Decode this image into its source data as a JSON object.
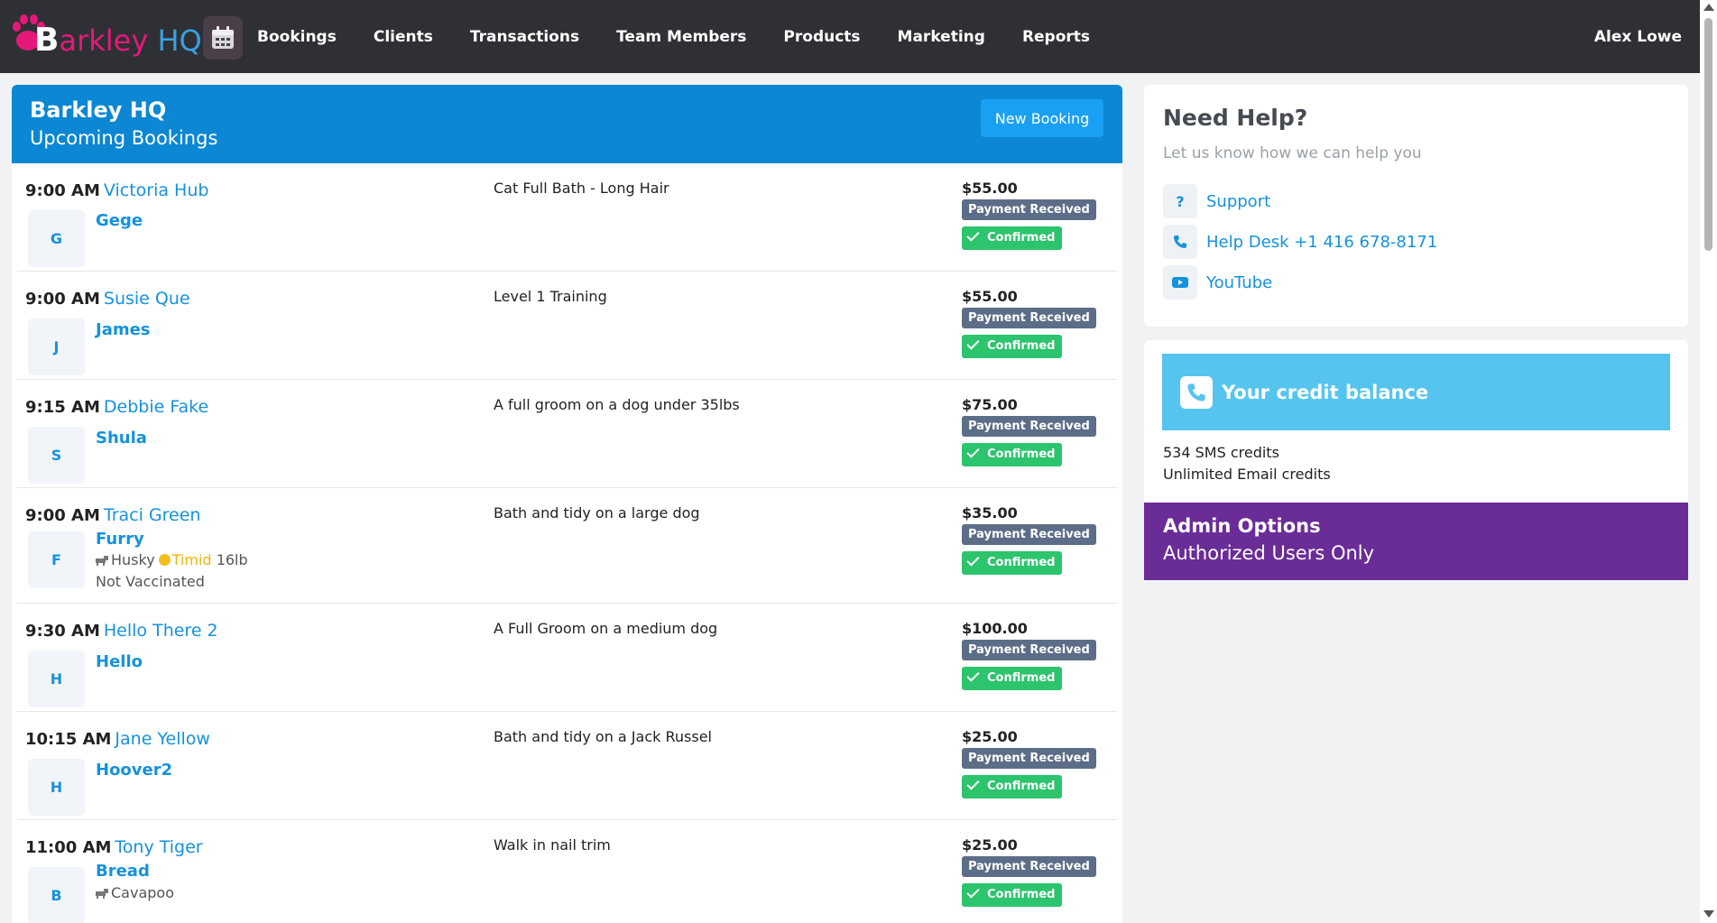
{
  "nav": {
    "brand_b": "B",
    "brand_arkley": "arkley",
    "brand_hq": "HQ",
    "items": [
      "Bookings",
      "Clients",
      "Transactions",
      "Team Members",
      "Products",
      "Marketing",
      "Reports"
    ],
    "user": "Alex Lowe"
  },
  "bookings": {
    "location": "Barkley HQ",
    "subtitle": "Upcoming Bookings",
    "new_booking_label": "New Booking",
    "rows": [
      {
        "time": "9:00 AM",
        "client": "Victoria Hub",
        "initial": "G",
        "pet": "Gege",
        "service": "Cat Full Bath - Long Hair",
        "price": "$55.00",
        "payment": "Payment Received",
        "status": "Confirmed"
      },
      {
        "time": "9:00 AM",
        "client": "Susie Que",
        "initial": "J",
        "pet": "James",
        "service": "Level 1 Training",
        "price": "$55.00",
        "payment": "Payment Received",
        "status": "Confirmed"
      },
      {
        "time": "9:15 AM",
        "client": "Debbie Fake",
        "initial": "S",
        "pet": "Shula",
        "service": "A full groom on a dog under 35lbs",
        "price": "$75.00",
        "payment": "Payment Received",
        "status": "Confirmed"
      },
      {
        "time": "9:00 AM",
        "client": "Traci Green",
        "initial": "F",
        "pet": "Furry",
        "breed": "Husky",
        "temperament": "Timid",
        "weight": "16lb",
        "vaccination": "Not Vaccinated",
        "service": "Bath and tidy on a large dog",
        "price": "$35.00",
        "payment": "Payment Received",
        "status": "Confirmed"
      },
      {
        "time": "9:30 AM",
        "client": "Hello There 2",
        "initial": "H",
        "pet": "Hello",
        "service": "A Full Groom on a medium dog",
        "price": "$100.00",
        "payment": "Payment Received",
        "status": "Confirmed"
      },
      {
        "time": "10:15 AM",
        "client": "Jane Yellow",
        "initial": "H",
        "pet": "Hoover2",
        "service": "Bath and tidy on a Jack Russel",
        "price": "$25.00",
        "payment": "Payment Received",
        "status": "Confirmed"
      },
      {
        "time": "11:00 AM",
        "client": "Tony Tiger",
        "initial": "B",
        "pet": "Bread",
        "breed": "Cavapoo",
        "service": "Walk in nail trim",
        "price": "$25.00",
        "payment": "Payment Received",
        "status": "Confirmed"
      }
    ]
  },
  "help": {
    "title": "Need Help?",
    "subtitle": "Let us know how we can help you",
    "links": [
      {
        "icon": "question-icon",
        "label": "Support"
      },
      {
        "icon": "phone-icon",
        "label": "Help Desk +1 416 678-8171"
      },
      {
        "icon": "youtube-icon",
        "label": "YouTube"
      }
    ]
  },
  "credit": {
    "title": "Your credit balance",
    "sms": "534 SMS credits",
    "email": "Unlimited Email credits"
  },
  "admin": {
    "title": "Admin Options",
    "subtitle": "Authorized Users Only"
  },
  "colors": {
    "topbar": "#2e3035",
    "header_blue": "#0b87d3",
    "link_blue": "#1592dc",
    "payment_badge": "#5c6d87",
    "confirmed_badge": "#2cc46d",
    "credit_bar": "#55c5ef",
    "admin_purple": "#6a2c97",
    "brand_pink": "#e5197a"
  }
}
